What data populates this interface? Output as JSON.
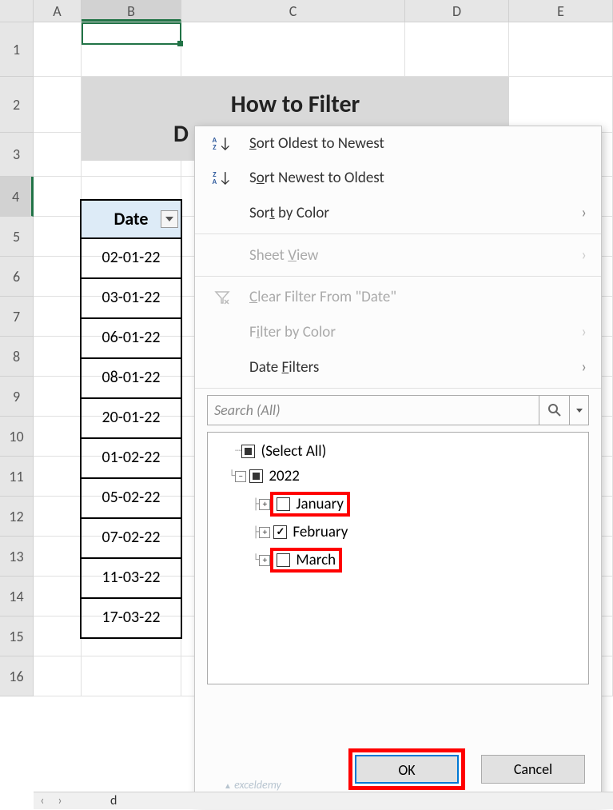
{
  "columns": [
    "A",
    "B",
    "C",
    "D",
    "E"
  ],
  "rows": [
    "1",
    "2",
    "3",
    "4",
    "5",
    "6",
    "7",
    "8",
    "9",
    "10",
    "11",
    "12",
    "13",
    "14",
    "15",
    "16"
  ],
  "selected_row": "4",
  "selected_col": "B",
  "title_line1": "How to Filter",
  "title_line2": "D",
  "table": {
    "header": "Date",
    "data": [
      "02-01-22",
      "03-01-22",
      "06-01-22",
      "08-01-22",
      "20-01-22",
      "01-02-22",
      "05-02-22",
      "07-02-22",
      "11-03-22",
      "17-03-22"
    ]
  },
  "menu": {
    "sort_oldest": "Sort Oldest to Newest",
    "sort_newest": "Sort Newest to Oldest",
    "sort_color": "Sort by Color",
    "sheet_view": "Sheet View",
    "clear_filter": "Clear Filter From \"Date\"",
    "filter_color": "Filter by Color",
    "date_filters": "Date Filters",
    "search_placeholder": "Search (All)",
    "tree": {
      "select_all": "(Select All)",
      "year": "2022",
      "months": [
        "January",
        "February",
        "March"
      ]
    },
    "ok": "OK",
    "cancel": "Cancel"
  },
  "sheet_tab": "d",
  "watermark": "exceldemy",
  "chart_data": {
    "type": "table",
    "title": "How to Filter",
    "columns": [
      "Date"
    ],
    "rows": [
      [
        "02-01-22"
      ],
      [
        "03-01-22"
      ],
      [
        "06-01-22"
      ],
      [
        "08-01-22"
      ],
      [
        "20-01-22"
      ],
      [
        "01-02-22"
      ],
      [
        "05-02-22"
      ],
      [
        "07-02-22"
      ],
      [
        "11-03-22"
      ],
      [
        "17-03-22"
      ]
    ],
    "filter": {
      "column": "Date",
      "tree": {
        "2022": {
          "January": false,
          "February": true,
          "March": false
        }
      }
    }
  }
}
